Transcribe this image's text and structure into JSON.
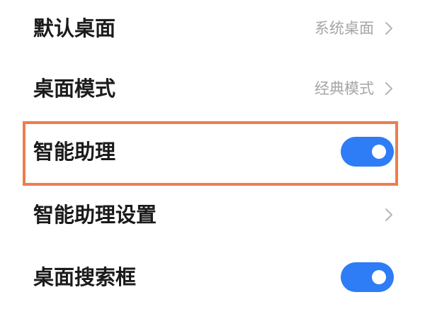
{
  "accent_color": "#2e7cf6",
  "highlight_color": "#ec7e4e",
  "settings": {
    "rows": [
      {
        "label": "默认桌面",
        "value": "系统桌面",
        "control": "chevron"
      },
      {
        "label": "桌面模式",
        "value": "经典模式",
        "control": "chevron"
      },
      {
        "label": "智能助理",
        "value": "",
        "control": "toggle",
        "checked": true,
        "highlighted": true
      },
      {
        "label": "智能助理设置",
        "value": "",
        "control": "chevron"
      },
      {
        "label": "桌面搜索框",
        "value": "",
        "control": "toggle",
        "checked": true
      }
    ]
  },
  "icons": {
    "chevron": "chevron-right-icon"
  }
}
